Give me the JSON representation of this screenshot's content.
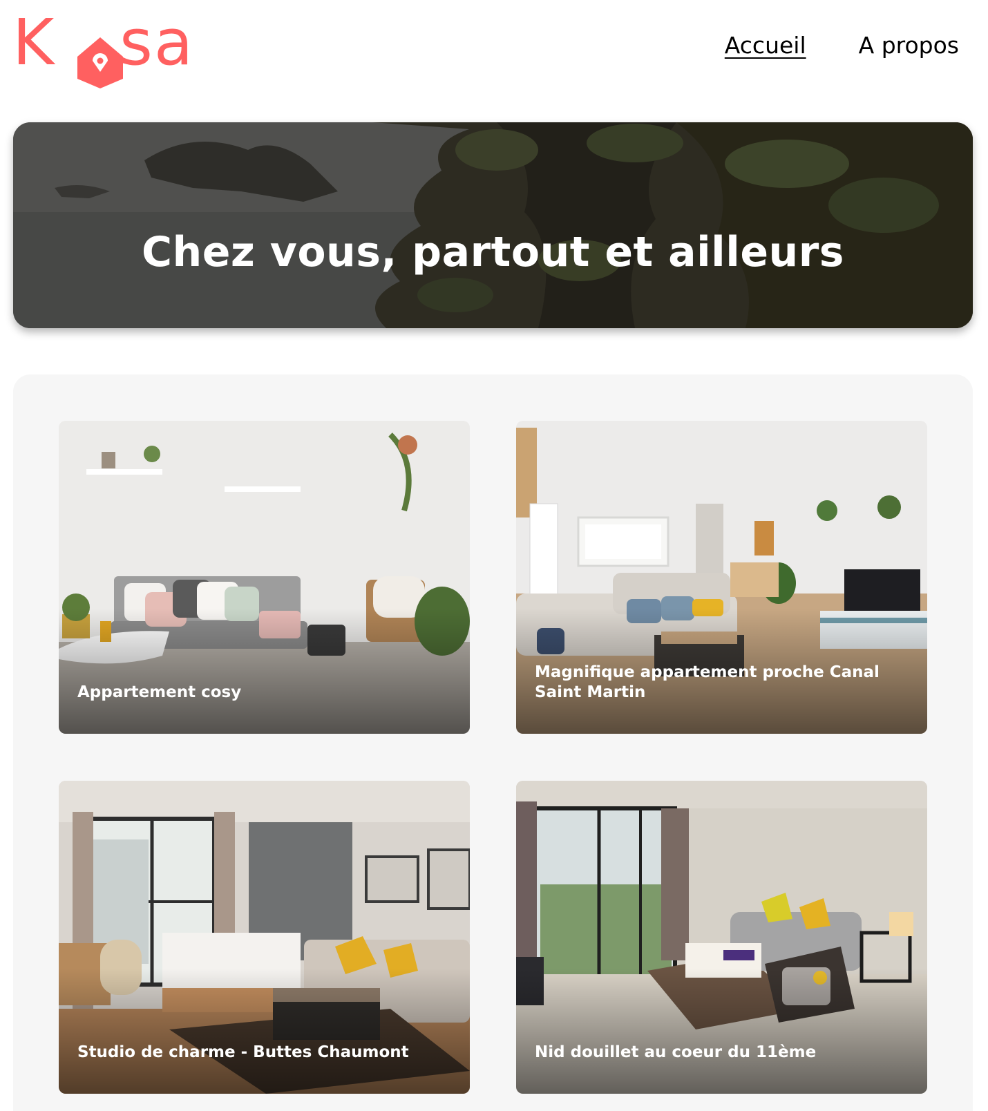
{
  "brand": {
    "logo_letters_left": "K",
    "logo_letters_right": "sa",
    "logo_icon": "house-icon",
    "color": "#FF6060"
  },
  "nav": {
    "home": "Accueil",
    "about": "A propos"
  },
  "banner": {
    "title": "Chez vous, partout et ailleurs"
  },
  "listings": [
    {
      "title": "Appartement cosy"
    },
    {
      "title": "Magnifique appartement proche Canal Saint Martin"
    },
    {
      "title": "Studio de charme - Buttes Chaumont"
    },
    {
      "title": "Nid douillet au coeur du 11ème"
    }
  ]
}
